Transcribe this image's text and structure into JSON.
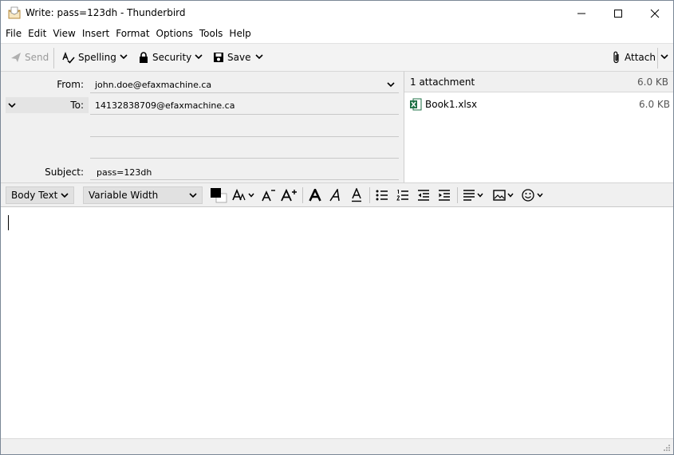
{
  "window": {
    "title": "Write: pass=123dh - Thunderbird",
    "controls": [
      "minimize-icon",
      "maximize-icon",
      "close-icon"
    ]
  },
  "menu": [
    "File",
    "Edit",
    "View",
    "Insert",
    "Format",
    "Options",
    "Tools",
    "Help"
  ],
  "toolbar": {
    "send_label": "Send",
    "spelling_label": "Spelling",
    "security_label": "Security",
    "save_label": "Save",
    "attach_label": "Attach"
  },
  "headers": {
    "from_label": "From:",
    "from_value": "john.doe@efaxmachine.ca",
    "to_label": "To:",
    "to_value": "14132838709@efaxmachine.ca",
    "subject_label": "Subject:",
    "subject_value": "pass=123dh"
  },
  "attachments": {
    "count_label": "1 attachment",
    "total_size": "6.0 KB",
    "items": [
      {
        "name": "Book1.xlsx",
        "size": "6.0 KB",
        "icon": "excel-file-icon"
      }
    ]
  },
  "format": {
    "paragraph_style": "Body Text",
    "font_family": "Variable Width"
  },
  "colors": {
    "excel_green": "#1e7145",
    "text_color_swatch": "#000000"
  }
}
